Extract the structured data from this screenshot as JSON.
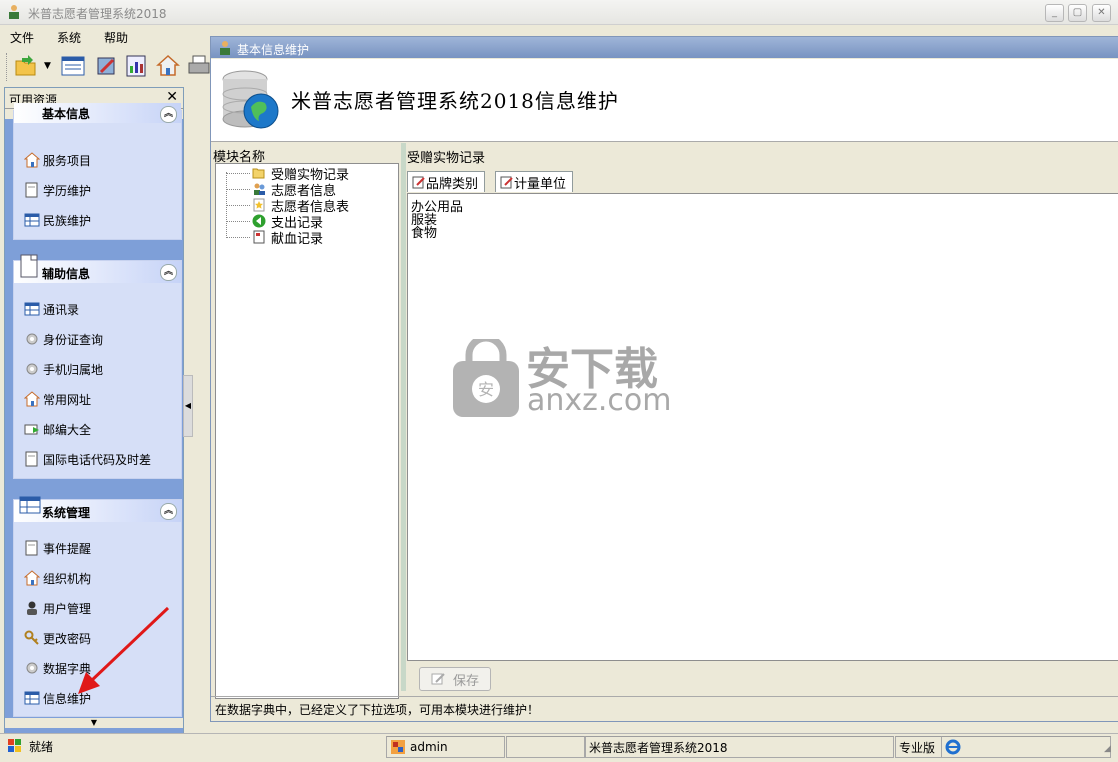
{
  "window": {
    "title": "米普志愿者管理系统2018",
    "buttons": [
      "min",
      "max",
      "close"
    ]
  },
  "menu": {
    "items": [
      "文件",
      "系统",
      "帮助"
    ]
  },
  "toolbar": {
    "icons": [
      "open-icon",
      "dropdown-arrow-icon",
      "list-icon",
      "tools-icon",
      "report-icon",
      "home-icon",
      "print-icon"
    ]
  },
  "left_panel": {
    "title": "可用资源",
    "close": "✕",
    "scroll_up": "▲",
    "scroll_down": "▼",
    "groups": [
      {
        "title": "基本信息",
        "collapse": "︽",
        "items": [
          {
            "label": "服务项目",
            "icon": "home-icon"
          },
          {
            "label": "学历维护",
            "icon": "document-icon"
          },
          {
            "label": "民族维护",
            "icon": "table-icon"
          }
        ]
      },
      {
        "title": "辅助信息",
        "collapse": "︽",
        "items": [
          {
            "label": "通讯录",
            "icon": "table-icon"
          },
          {
            "label": "身份证查询",
            "icon": "gear-icon"
          },
          {
            "label": "手机归属地",
            "icon": "gear-icon"
          },
          {
            "label": "常用网址",
            "icon": "home-icon"
          },
          {
            "label": "邮编大全",
            "icon": "mail-icon"
          },
          {
            "label": "国际电话代码及时差",
            "icon": "document-icon"
          }
        ]
      },
      {
        "title": "系统管理",
        "collapse": "︽",
        "items": [
          {
            "label": "事件提醒",
            "icon": "document-icon"
          },
          {
            "label": "组织机构",
            "icon": "home-icon"
          },
          {
            "label": "用户管理",
            "icon": "user-icon"
          },
          {
            "label": "更改密码",
            "icon": "key-icon"
          },
          {
            "label": "数据字典",
            "icon": "gear-icon"
          },
          {
            "label": "信息维护",
            "icon": "table-icon"
          }
        ]
      }
    ]
  },
  "child_window": {
    "title": "基本信息维护",
    "banner_heading": "米普志愿者管理系统2018信息维护",
    "module_header": "模块名称",
    "modules": [
      {
        "label": "受赠实物记录",
        "icon": "folder-open-icon"
      },
      {
        "label": "志愿者信息",
        "icon": "users-icon"
      },
      {
        "label": "志愿者信息表",
        "icon": "star-document-icon"
      },
      {
        "label": "支出记录",
        "icon": "green-arrow-icon"
      },
      {
        "label": "献血记录",
        "icon": "document-icon"
      }
    ],
    "right_header": "受赠实物记录",
    "tabs": [
      "品牌类别",
      "计量单位"
    ],
    "list_items": [
      "办公用品",
      "服装",
      "食物"
    ],
    "save_label": "保存",
    "status_text": "在数据字典中，已经定义了下拉选项，可用本模块进行维护！"
  },
  "statusbar": {
    "ready": "就绪",
    "user": "admin",
    "product": "米普志愿者管理系统2018",
    "edition": "专业版"
  },
  "watermark": {
    "text1": "安下载",
    "text2": "anxz.com"
  }
}
